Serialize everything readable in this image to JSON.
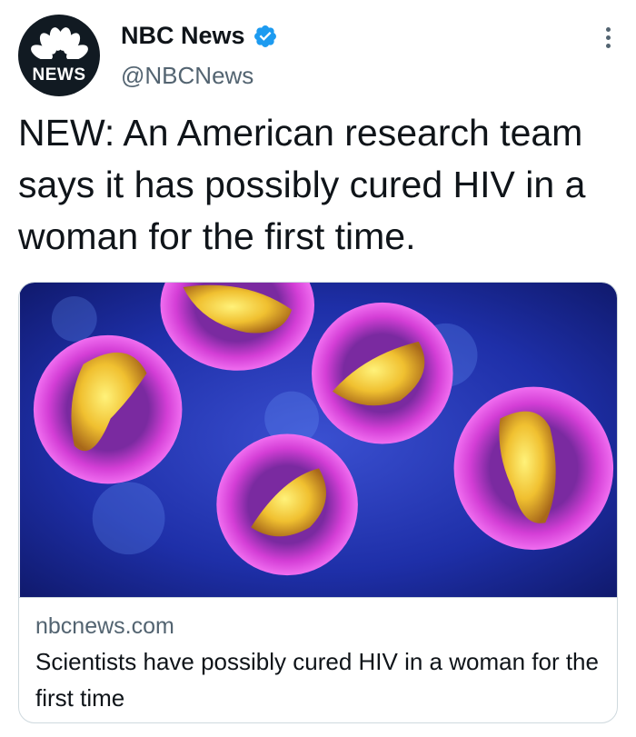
{
  "account": {
    "name": "NBC News",
    "handle": "@NBCNews",
    "avatar_text": "NEWS",
    "verified": true,
    "verified_icon": "verified-badge-icon",
    "more_icon": "more-options-icon"
  },
  "tweet": {
    "text": "NEW: An American research team says it has possibly cured HIV in a woman for the first time."
  },
  "card": {
    "image_description_icon": "virus-micrograph-image",
    "domain": "nbcnews.com",
    "title": "Scientists have possibly cured HIV in a woman for the first time"
  },
  "colors": {
    "text_primary": "#0f1419",
    "text_secondary": "#536471",
    "verified_blue": "#1d9bf0",
    "border": "#cfd9de",
    "avatar_bg": "#111a22"
  }
}
